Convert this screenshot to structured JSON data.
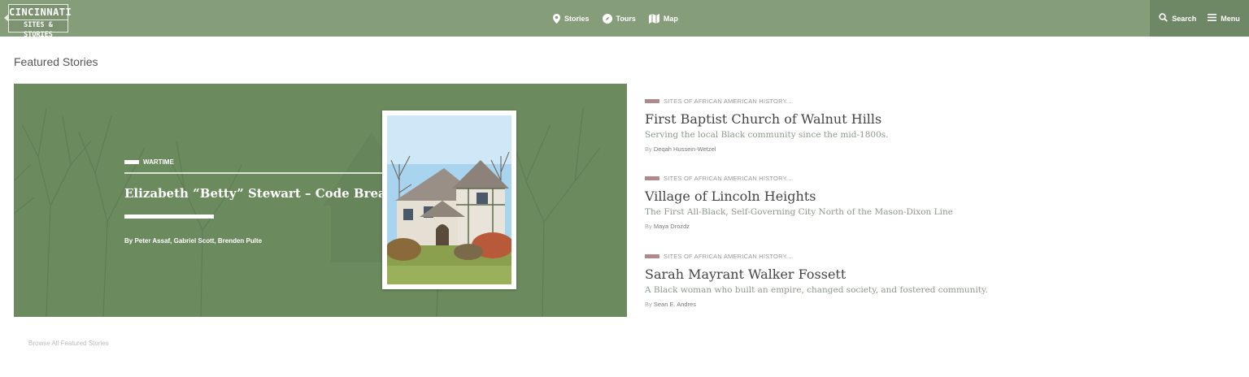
{
  "header": {
    "logo_line1": "CINCINNATI",
    "logo_line2": "SITES & STORIES",
    "nav": [
      {
        "label": "Stories",
        "icon": "map-pin-icon"
      },
      {
        "label": "Tours",
        "icon": "compass-icon"
      },
      {
        "label": "Map",
        "icon": "folded-map-icon"
      }
    ],
    "search_label": "Search",
    "menu_label": "Menu"
  },
  "section_title": "Featured Stories",
  "featured": {
    "category": "WARTIME",
    "title": "Elizabeth “Betty” Stewart – Code Breaker",
    "byline": "By Peter Assaf, Gabriel Scott, Brenden Pulte"
  },
  "stories": [
    {
      "category": "SITES OF AFRICAN AMERICAN HISTORY...",
      "title": "First Baptist Church of Walnut Hills",
      "description": "Serving the local Black community since the mid-1800s.",
      "by": "By",
      "author": "Deqah Hussein-Wetzel"
    },
    {
      "category": "SITES OF AFRICAN AMERICAN HISTORY...",
      "title": "Village of Lincoln Heights",
      "description": "The First All-Black, Self-Governing City North of the Mason-Dixon Line",
      "by": "By",
      "author": "Maya Drozdz"
    },
    {
      "category": "SITES OF AFRICAN AMERICAN HISTORY...",
      "title": "Sarah Mayrant Walker Fossett",
      "description": "A Black woman who built an empire, changed society, and fostered community.",
      "by": "By",
      "author": "Sean E. Andres"
    }
  ],
  "browse_label": "Browse All Featured Stories",
  "colors": {
    "header": "#869d7a",
    "header_util": "#6e8764",
    "feature_bg": "#6b8a5e",
    "category_bar": "#b08a8a"
  }
}
